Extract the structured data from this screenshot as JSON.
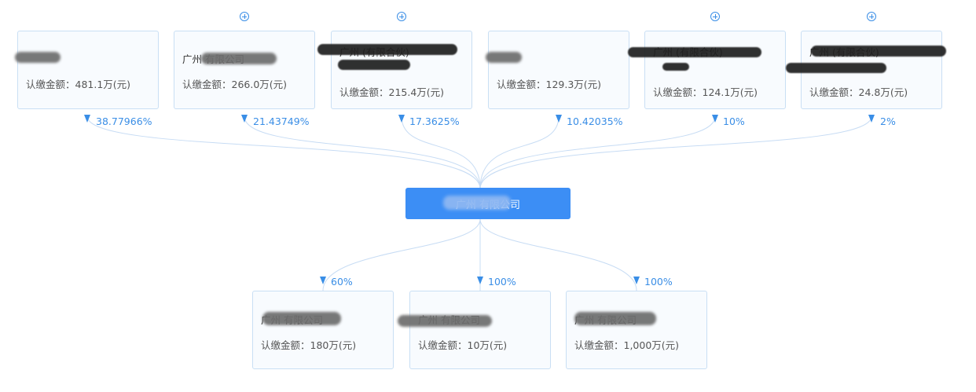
{
  "company": {
    "name": "广州 有限公司"
  },
  "shareholders": [
    {
      "name": "",
      "amount": "认缴金额：481.1万(元)",
      "percent": "38.77966%",
      "expandable": false
    },
    {
      "name": "广州 有限公司",
      "amount": "认缴金额：266.0万(元)",
      "percent": "21.43749%",
      "expandable": true
    },
    {
      "name": "广州 (有限合伙)",
      "amount": "认缴金额：215.4万(元)",
      "percent": "17.3625%",
      "expandable": true
    },
    {
      "name": "",
      "amount": "认缴金额：129.3万(元)",
      "percent": "10.42035%",
      "expandable": false
    },
    {
      "name": "广州 (有限合伙)",
      "amount": "认缴金额：124.1万(元)",
      "percent": "10%",
      "expandable": true
    },
    {
      "name": "广州 (有限合伙)",
      "amount": "认缴金额：24.8万(元)",
      "percent": "2%",
      "expandable": true
    }
  ],
  "investments": [
    {
      "name": "广州 有限公司",
      "amount": "认缴金额：180万(元)",
      "percent": "60%"
    },
    {
      "name": "广州 有限公司",
      "amount": "认缴金额：10万(元)",
      "percent": "100%"
    },
    {
      "name": "广州 有限公司",
      "amount": "认缴金额：1,000万(元)",
      "percent": "100%"
    }
  ],
  "colors": {
    "accent": "#3c8ef5",
    "link": "#c7dcf4",
    "label": "#3a8ee6",
    "card_bg": "#f8fbfe",
    "card_border": "#c9dff4"
  },
  "icons": {
    "expand": "plus-circle-icon",
    "arrow": "arrow-down-icon"
  }
}
